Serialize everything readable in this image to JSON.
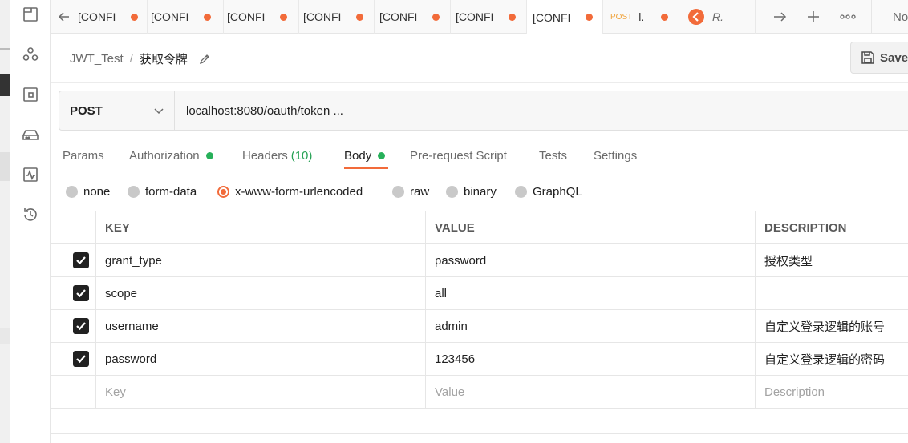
{
  "tabs": [
    {
      "label": "[CONFI",
      "dirty": true
    },
    {
      "label": "[CONFI",
      "dirty": true
    },
    {
      "label": "[CONFI",
      "dirty": true
    },
    {
      "label": "[CONFI",
      "dirty": true
    },
    {
      "label": "[CONFI",
      "dirty": true
    },
    {
      "label": "[CONFI",
      "dirty": true
    },
    {
      "label": "[CONFI",
      "dirty": true,
      "active": true
    }
  ],
  "post_tab": {
    "method": "POST",
    "label": "l."
  },
  "runner_tab": {
    "label": "R."
  },
  "overflow_label": "No",
  "breadcrumb": {
    "collection": "JWT_Test",
    "separator": "/",
    "request": "获取令牌"
  },
  "save_label": "Save",
  "request": {
    "method": "POST",
    "url": "localhost:8080/oauth/token ..."
  },
  "request_tabs": {
    "params": "Params",
    "authorization": "Authorization",
    "headers": "Headers",
    "headers_count": "(10)",
    "body": "Body",
    "prerequest": "Pre-request Script",
    "tests": "Tests",
    "settings": "Settings"
  },
  "body_types": {
    "none": "none",
    "form_data": "form-data",
    "urlencoded": "x-www-form-urlencoded",
    "raw": "raw",
    "binary": "binary",
    "graphql": "GraphQL",
    "selected": "x-www-form-urlencoded"
  },
  "table": {
    "headers": {
      "key": "KEY",
      "value": "VALUE",
      "description": "DESCRIPTION"
    },
    "rows": [
      {
        "checked": true,
        "key": "grant_type",
        "value": "password",
        "description": "授权类型"
      },
      {
        "checked": true,
        "key": "scope",
        "value": "all",
        "description": ""
      },
      {
        "checked": true,
        "key": "username",
        "value": "admin",
        "description": "自定义登录逻辑的账号"
      },
      {
        "checked": true,
        "key": "password",
        "value": "123456",
        "description": "自定义登录逻辑的密码"
      }
    ],
    "placeholders": {
      "key": "Key",
      "value": "Value",
      "description": "Description"
    }
  },
  "colors": {
    "accent": "#f26b3a",
    "status_green": "#27b05a"
  }
}
